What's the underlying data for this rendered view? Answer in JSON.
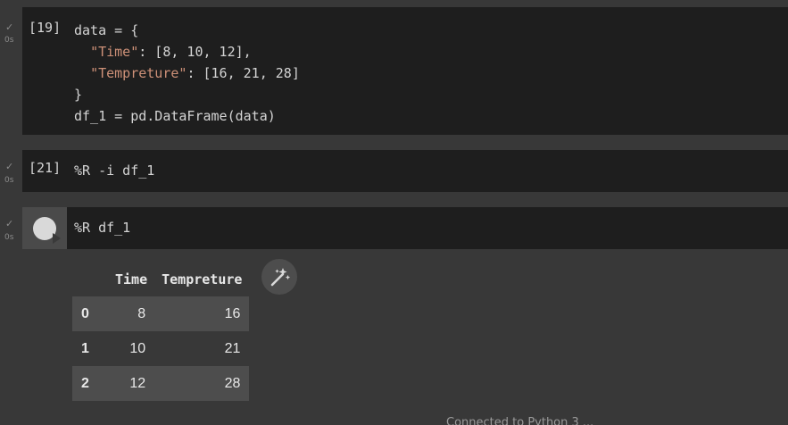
{
  "cells": [
    {
      "exec_count": "[19]",
      "time": "0s",
      "lines": [
        {
          "parts": [
            {
              "t": "data = {",
              "c": ""
            }
          ]
        },
        {
          "parts": [
            {
              "t": "  ",
              "c": ""
            },
            {
              "t": "\"Time\"",
              "c": "s"
            },
            {
              "t": ": [8, 10, 12],",
              "c": ""
            }
          ]
        },
        {
          "parts": [
            {
              "t": "  ",
              "c": ""
            },
            {
              "t": "\"Tempreture\"",
              "c": "s"
            },
            {
              "t": ": [16, 21, 28]",
              "c": ""
            }
          ]
        },
        {
          "parts": [
            {
              "t": "}",
              "c": ""
            }
          ]
        },
        {
          "parts": [
            {
              "t": "df_1 = pd.DataFrame(data)",
              "c": ""
            }
          ]
        }
      ]
    },
    {
      "exec_count": "[21]",
      "time": "0s",
      "code": "%R -i df_1"
    },
    {
      "time": "0s",
      "code": "%R df_1"
    }
  ],
  "dataframe": {
    "columns": [
      "Time",
      "Tempreture"
    ],
    "rows": [
      {
        "index": "0",
        "values": [
          "8",
          "16"
        ]
      },
      {
        "index": "1",
        "values": [
          "10",
          "21"
        ]
      },
      {
        "index": "2",
        "values": [
          "12",
          "28"
        ]
      }
    ]
  },
  "check_glyph": "✓",
  "icons": {
    "run": "play-icon",
    "magic": "magic-wand-icon"
  },
  "colors": {
    "background": "#383838",
    "cell": "#1e1e1e",
    "string": "#ce9178"
  },
  "footer_text": "Connected to Python 3 ..."
}
